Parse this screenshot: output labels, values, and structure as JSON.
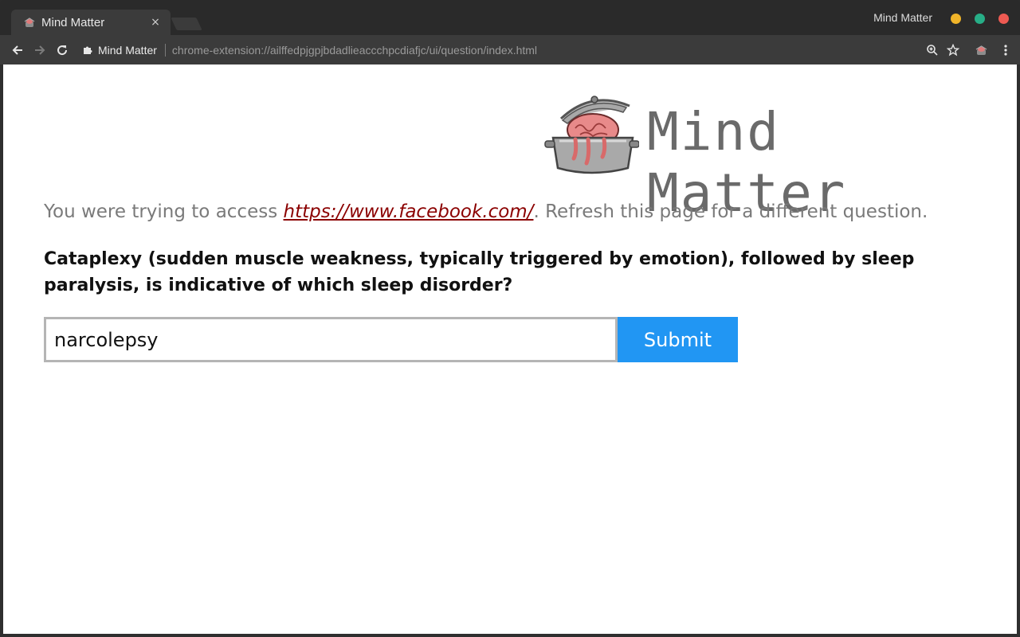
{
  "browser": {
    "tab": {
      "title": "Mind Matter",
      "close_glyph": "×"
    },
    "window_title": "Mind Matter",
    "window_controls": {
      "minimize_color": "#f0b429",
      "maximize_color": "#27ae87",
      "close_color": "#ee5a52"
    },
    "omnibox": {
      "chip_label": "Mind Matter",
      "url": "chrome-extension://ailffedpjgpjbdadlieaccchpcdiafjc/ui/question/index.html"
    }
  },
  "page": {
    "logo_text": "Mind Matter",
    "access": {
      "prefix": "You were trying to access ",
      "link": "https://www.facebook.com/",
      "suffix": ". Refresh this page for a different question."
    },
    "question": "Cataplexy (sudden muscle weakness, typically triggered by emotion), followed by sleep paralysis, is indicative of which sleep disorder?",
    "answer_value": "narcolepsy",
    "submit_label": "Submit",
    "accent_color": "#2196f3",
    "link_color": "#8b0000"
  }
}
